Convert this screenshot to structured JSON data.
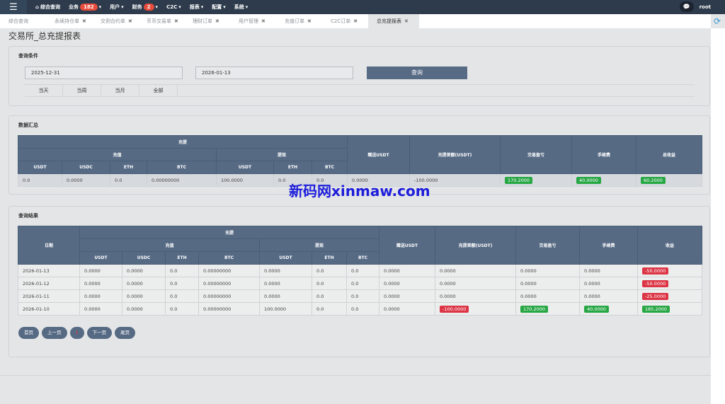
{
  "nav": {
    "home": "综合查询",
    "business": "业务",
    "business_badge": "182",
    "user": "用户",
    "finance": "财务",
    "finance_badge": "2",
    "c2c": "C2C",
    "report": "报表",
    "config": "配置",
    "system": "系统",
    "username": "root"
  },
  "tabs": [
    "综合查询",
    "永续持仓单",
    "交割合约单",
    "币币交易单",
    "理财订单",
    "用户管理",
    "充值订单",
    "C2C订单",
    "总充提报表"
  ],
  "page_title": "交易所_总充提报表",
  "query": {
    "title": "查询条件",
    "start_date": "2025-12-31",
    "end_date": "2026-01-13",
    "search_label": "查询",
    "quick": [
      "当天",
      "当周",
      "当月",
      "全部"
    ]
  },
  "summary": {
    "title": "数据汇总",
    "h_group": "充提",
    "h_deposit": "充值",
    "h_withdraw": "提现",
    "h_gift": "赠送USDT",
    "h_diff": "充提差额(USDT)",
    "h_pnl": "交易盈亏",
    "h_fee": "手续费",
    "h_total": "总收益",
    "sub": [
      "USDT",
      "USDC",
      "ETH",
      "BTC",
      "USDT",
      "ETH",
      "BTC"
    ],
    "row": [
      "0.0",
      "0.0000",
      "0.0",
      "0.00000000",
      "100.0000",
      "0.0",
      "0.0",
      "0.0000",
      "-100.0000",
      "170.2000",
      "40.0000",
      "60.2000"
    ]
  },
  "results": {
    "title": "查询结果",
    "h_date": "日期",
    "h_group": "充提",
    "h_deposit": "充值",
    "h_withdraw": "提现",
    "h_gift": "赠送USDT",
    "h_diff": "充提差额(USDT)",
    "h_pnl": "交易盈亏",
    "h_fee": "手续费",
    "h_income": "收益",
    "sub": [
      "USDT",
      "USDC",
      "ETH",
      "BTC",
      "USDT",
      "ETH",
      "BTC"
    ],
    "rows": [
      [
        "2026-01-13",
        "0.0000",
        "0.0000",
        "0.0",
        "0.00000000",
        "0.0000",
        "0.0",
        "0.0",
        "0.0000",
        "0.0000",
        "0.0000",
        "0.0000",
        "-50.0000"
      ],
      [
        "2026-01-12",
        "0.0000",
        "0.0000",
        "0.0",
        "0.00000000",
        "0.0000",
        "0.0",
        "0.0",
        "0.0000",
        "0.0000",
        "0.0000",
        "0.0000",
        "-50.0000"
      ],
      [
        "2026-01-11",
        "0.0000",
        "0.0000",
        "0.0",
        "0.00000000",
        "0.0000",
        "0.0",
        "0.0",
        "0.0000",
        "0.0000",
        "0.0000",
        "0.0000",
        "-25.0000"
      ],
      [
        "2026-01-10",
        "0.0000",
        "0.0000",
        "0.0",
        "0.00000000",
        "100.0000",
        "0.0",
        "0.0",
        "0.0000",
        "-100.0000",
        "170.2000",
        "40.0000",
        "185.2000"
      ]
    ]
  },
  "pager": {
    "first": "首页",
    "prev": "上一页",
    "current": "1",
    "next": "下一页",
    "last": "尾页"
  },
  "watermark": "新码网xinmaw.com"
}
